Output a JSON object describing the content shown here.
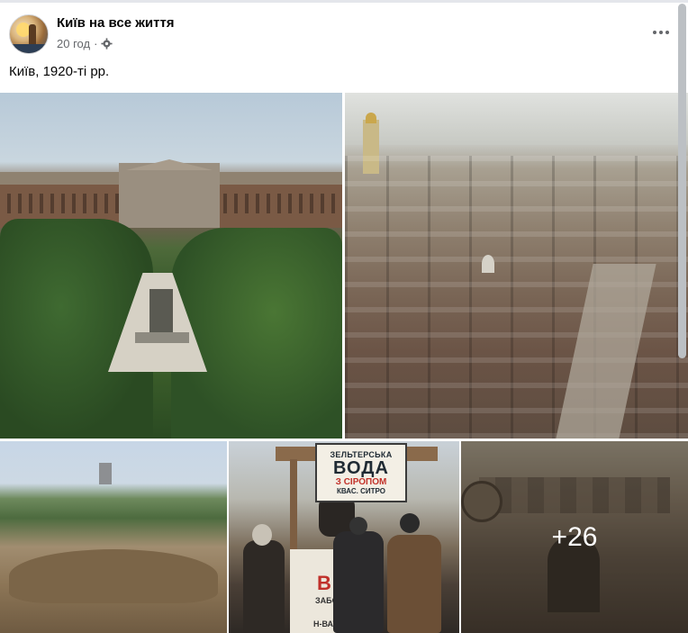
{
  "post": {
    "page_name": "Київ на все життя",
    "time": "20 год",
    "separator": "·",
    "audience_icon": "gear-icon",
    "more_icon": "more-horizontal-icon",
    "text": "Київ, 1920-ті рр."
  },
  "photos": {
    "sign": {
      "line1": "ЗЕЛЬТЕРСЬКА",
      "line2": "ВОДА",
      "line3": "З СІРОПОМ",
      "line4": "КВАС. СИТРО"
    },
    "counter": {
      "letter": "В",
      "sub1": "ЗАБО",
      "sub2": "Н-ВАТ"
    },
    "more_count": "+26"
  },
  "colors": {
    "text_primary": "#050505",
    "text_secondary": "#65676b",
    "background": "#ffffff"
  }
}
